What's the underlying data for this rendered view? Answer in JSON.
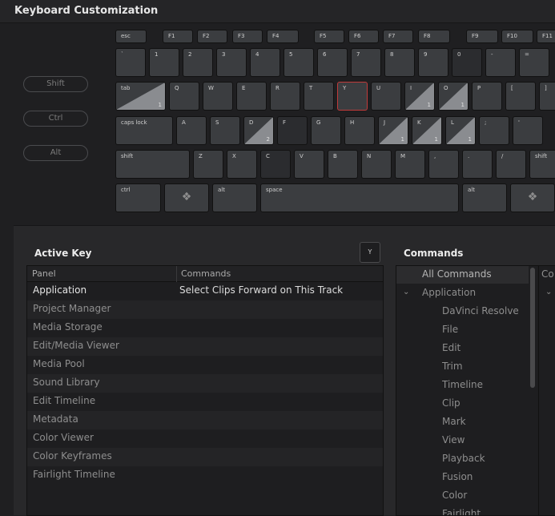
{
  "window": {
    "title": "Keyboard Customization"
  },
  "modifiers": [
    "Shift",
    "Ctrl",
    "Alt"
  ],
  "keyboard": {
    "fn": [
      "esc",
      "F1",
      "F2",
      "F3",
      "F4",
      "F5",
      "F6",
      "F7",
      "F8",
      "F9",
      "F10",
      "F11"
    ],
    "num": [
      "`",
      "1",
      "2",
      "3",
      "4",
      "5",
      "6",
      "7",
      "8",
      "9",
      "0",
      "-",
      "="
    ],
    "qwerty": [
      "tab",
      "Q",
      "W",
      "E",
      "R",
      "T",
      "Y",
      "U",
      "I",
      "O",
      "P",
      "[",
      "]"
    ],
    "home": [
      "caps lock",
      "A",
      "S",
      "D",
      "F",
      "G",
      "H",
      "J",
      "K",
      "L",
      ";",
      "'"
    ],
    "shiftrow": [
      "shift",
      "Z",
      "X",
      "C",
      "V",
      "B",
      "N",
      "M",
      ",",
      ".",
      "/",
      "shift"
    ],
    "bottom": [
      "ctrl",
      "",
      "alt",
      "space",
      "alt",
      ""
    ],
    "counts": {
      "tab": "1",
      "I": "1",
      "O": "1",
      "D": "2",
      "J": "1",
      "K": "1",
      "L": "1"
    }
  },
  "active_key": {
    "title": "Active Key",
    "key_button": "Y",
    "columns": [
      "Panel",
      "Commands"
    ],
    "rows": [
      {
        "panel": "Application",
        "command": "Select Clips Forward on This Track"
      },
      {
        "panel": "Project Manager",
        "command": ""
      },
      {
        "panel": "Media Storage",
        "command": ""
      },
      {
        "panel": "Edit/Media Viewer",
        "command": ""
      },
      {
        "panel": "Media Pool",
        "command": ""
      },
      {
        "panel": "Sound Library",
        "command": ""
      },
      {
        "panel": "Edit Timeline",
        "command": ""
      },
      {
        "panel": "Metadata",
        "command": ""
      },
      {
        "panel": "Color Viewer",
        "command": ""
      },
      {
        "panel": "Color Keyframes",
        "command": ""
      },
      {
        "panel": "Fairlight Timeline",
        "command": ""
      }
    ]
  },
  "commands": {
    "title": "Commands",
    "all": "All Commands",
    "group": "Application",
    "items": [
      "DaVinci Resolve",
      "File",
      "Edit",
      "Trim",
      "Timeline",
      "Clip",
      "Mark",
      "View",
      "Playback",
      "Fusion",
      "Color",
      "Fairlight"
    ],
    "side_header": "Co"
  }
}
